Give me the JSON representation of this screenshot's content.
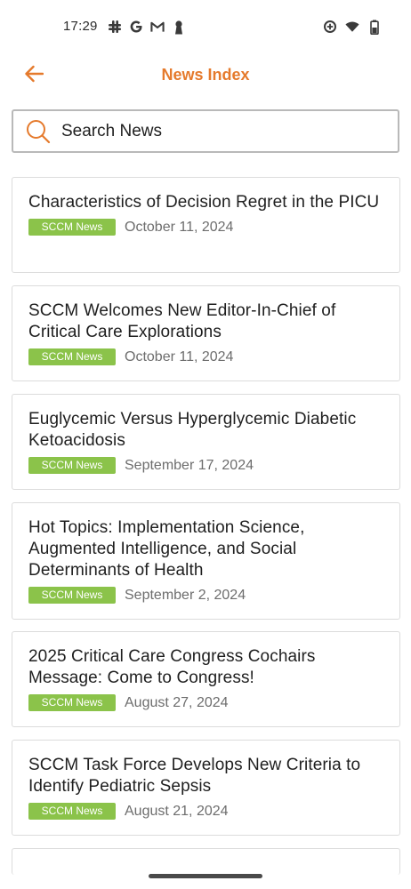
{
  "status_bar": {
    "time": "17:29",
    "left_icons": [
      "slack-icon",
      "google-icon",
      "gmail-icon",
      "keyhole-icon"
    ],
    "right_icons": [
      "data-saver-icon",
      "wifi-icon",
      "battery-icon"
    ]
  },
  "header": {
    "title": "News Index",
    "accent_color": "#e57a2c"
  },
  "search": {
    "placeholder": "Search News",
    "value": ""
  },
  "news": {
    "badge_color": "#8bc34a",
    "items": [
      {
        "title": "Characteristics of Decision Regret in the PICU",
        "category": "SCCM News",
        "date": "October 11, 2024"
      },
      {
        "title": "SCCM Welcomes New Editor-In-Chief of Critical Care Explorations",
        "category": "SCCM News",
        "date": "October 11, 2024"
      },
      {
        "title": "Euglycemic Versus Hyperglycemic Diabetic Ketoacidosis",
        "category": "SCCM News",
        "date": "September 17, 2024"
      },
      {
        "title": "Hot Topics: Implementation Science, Augmented Intelligence, and Social Determinants of Health",
        "category": "SCCM News",
        "date": "September 2, 2024"
      },
      {
        "title": "2025 Critical Care Congress Cochairs Message: Come to Congress!",
        "category": "SCCM News",
        "date": "August 27, 2024"
      },
      {
        "title": "SCCM Task Force Develops New Criteria to Identify Pediatric Sepsis",
        "category": "SCCM News",
        "date": "August 21, 2024"
      }
    ]
  }
}
